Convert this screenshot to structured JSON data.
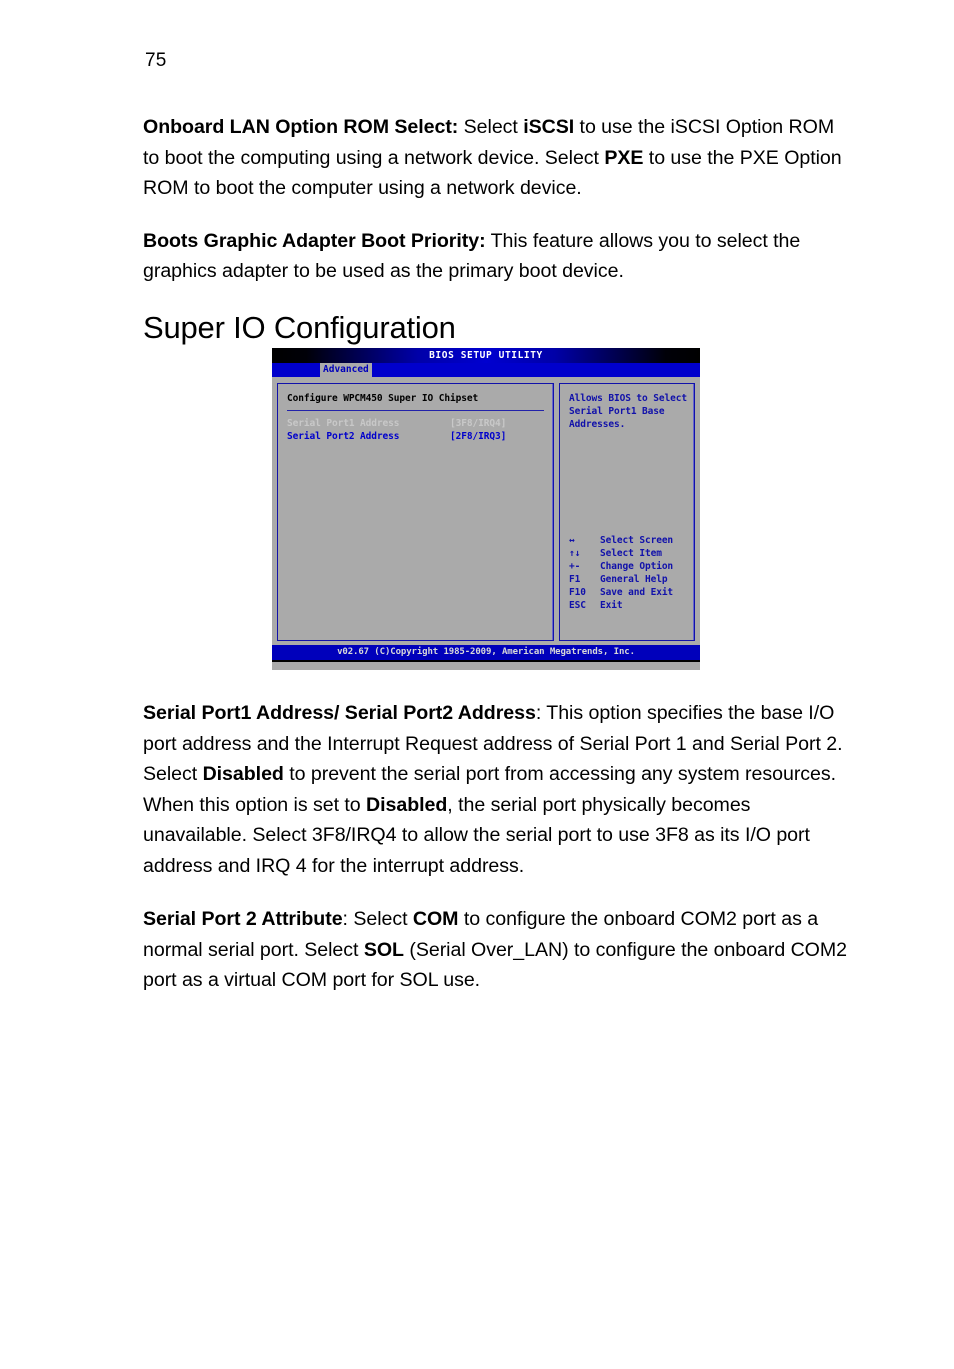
{
  "page": {
    "number": "75"
  },
  "paragraphs": {
    "onboard_lan": {
      "lead": "Onboard LAN Option ROM Select:",
      "t1": " Select ",
      "b1": "iSCSI",
      "t2": " to use the iSCSI Option ROM to boot the computing using a network device. Select ",
      "b2": "PXE",
      "t3": " to use the PXE Option ROM to boot the computer using a network device."
    },
    "boots_graphic": {
      "lead": "Boots Graphic Adapter Boot Priority:",
      "t1": " This feature allows you to select the graphics adapter to be used as the primary boot device."
    },
    "serial_address": {
      "lead": "Serial Port1 Address/ Serial Port2 Address",
      "t1": ": This option specifies the base I/O port address and the Interrupt Request address of Serial Port 1 and Serial Port 2. Select ",
      "b1": "Disabled",
      "t2": " to prevent the serial port from accessing any system resources. When this option is set to ",
      "b2": "Disabled",
      "t3": ", the serial port physically becomes unavailable. Select 3F8/IRQ4 to allow the serial port to use 3F8 as its I/O port address and IRQ 4 for the interrupt address."
    },
    "serial_attribute": {
      "lead": "Serial Port 2 Attribute",
      "t1": ": Select ",
      "b1": "COM",
      "t2": " to configure the onboard COM2 port as a normal serial port. Select ",
      "b2": "SOL",
      "t3": " (Serial Over_LAN) to configure the onboard COM2 port as a virtual COM port for SOL use."
    }
  },
  "heading": {
    "title": "Super IO Configuration"
  },
  "bios": {
    "title": "BIOS SETUP UTILITY",
    "tabs": [
      {
        "label": "Advanced",
        "active": true
      }
    ],
    "config_title": "Configure WPCM450 Super IO Chipset",
    "settings": [
      {
        "label": "Serial Port1 Address",
        "value": "[3F8/IRQ4]",
        "selected": true
      },
      {
        "label": "Serial Port2 Address",
        "value": "[2F8/IRQ3]",
        "selected": false
      }
    ],
    "help": {
      "line1": "Allows BIOS to Select",
      "line2": "Serial Port1 Base",
      "line3": "Addresses."
    },
    "legend": [
      {
        "key": "↔",
        "desc": "Select Screen"
      },
      {
        "key": "↑↓",
        "desc": "Select Item"
      },
      {
        "key": "+-",
        "desc": "Change Option"
      },
      {
        "key": "F1",
        "desc": "General Help"
      },
      {
        "key": "F10",
        "desc": "Save and Exit"
      },
      {
        "key": "ESC",
        "desc": "Exit"
      }
    ],
    "footer": "v02.67 (C)Copyright 1985-2009, American Megatrends, Inc.",
    "colors": {
      "title_bar_blue": "#0000d0",
      "tab_bar_blue": "#0000cc",
      "body_gray": "#aaaaaa",
      "text_blue": "#0000cc",
      "selected_gray": "#c8c8c8",
      "footer_blue": "#0000bb"
    }
  }
}
